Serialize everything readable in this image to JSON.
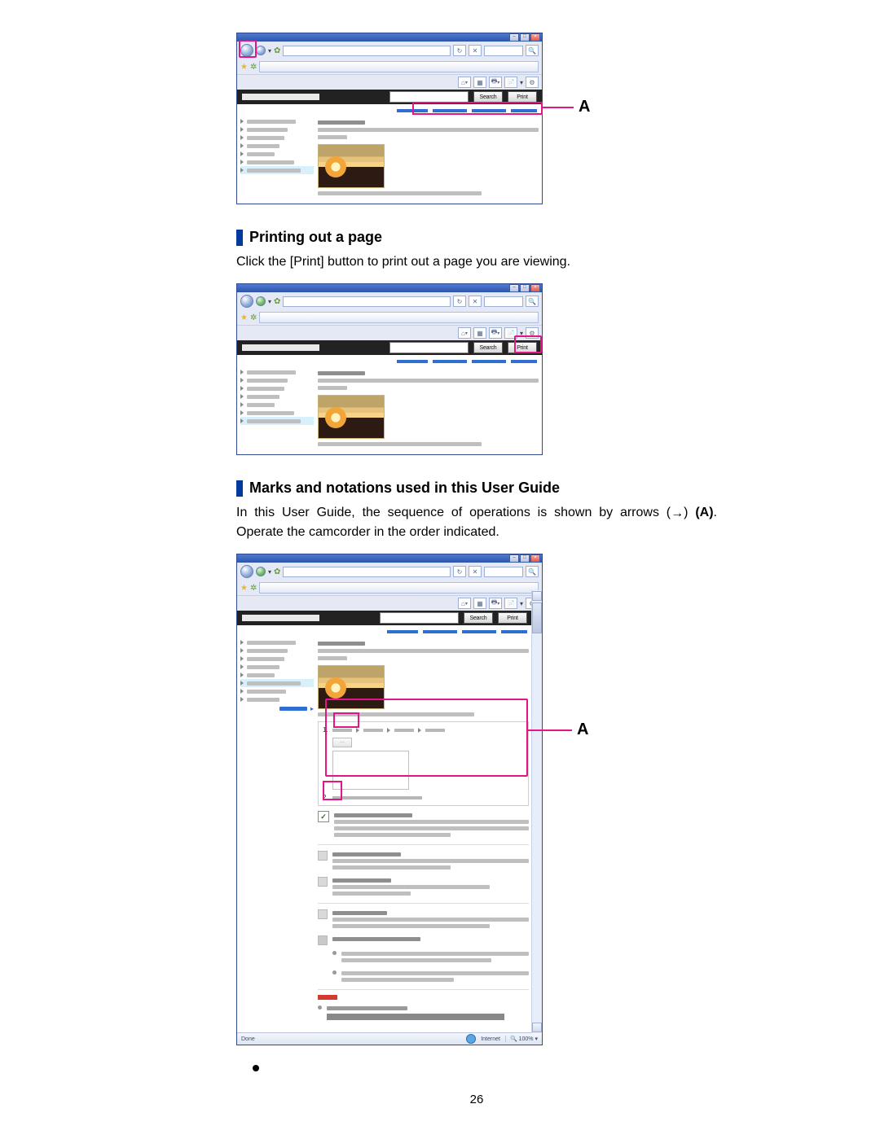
{
  "page_number": "26",
  "section1": {
    "heading": "Printing out a page",
    "body": "Click the [Print] button to print out a page you are viewing."
  },
  "section2": {
    "heading": "Marks and notations used in this User Guide",
    "body_pre": "In this User Guide, the sequence of operations is shown by arrows (",
    "body_post": ") ",
    "body_label": "(A)",
    "body_tail": ". Operate the camcorder in the order indicated."
  },
  "figure_common": {
    "search_button": "Search",
    "print_button": "Print",
    "callout_label": "A",
    "step1": "1.",
    "step2": "2.",
    "status_text": "Internet",
    "zoom_text": "100%"
  }
}
